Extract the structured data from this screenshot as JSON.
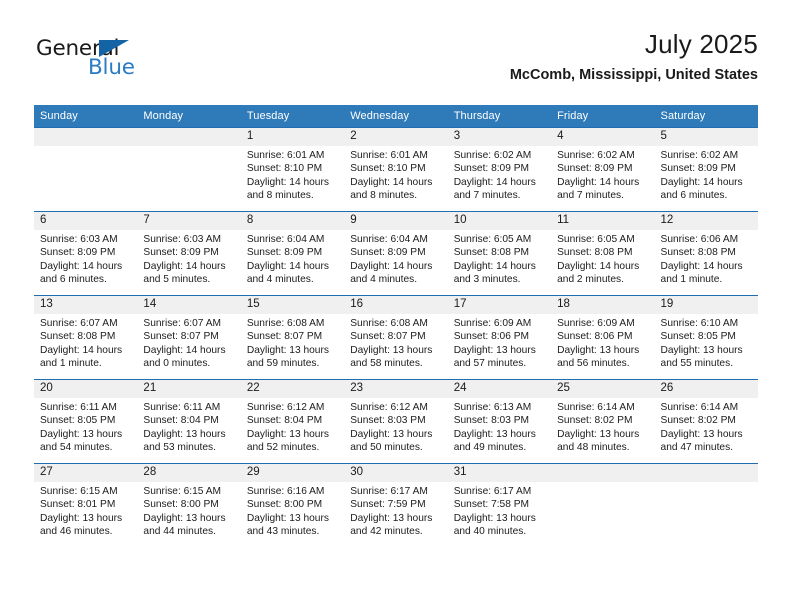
{
  "brand": {
    "name_dark": "General",
    "name_blue": "Blue",
    "accent_blue": "#2b7cc4",
    "triangle_blue": "#1464a5"
  },
  "header": {
    "title": "July 2025",
    "subtitle": "McComb, Mississippi, United States"
  },
  "calendar": {
    "header_bg": "#2f7ab8",
    "daynum_bg": "#f0f0f0",
    "row_border": "#1f6cb0",
    "weekday_labels": [
      "Sunday",
      "Monday",
      "Tuesday",
      "Wednesday",
      "Thursday",
      "Friday",
      "Saturday"
    ],
    "weeks": [
      [
        {
          "day": "",
          "detail": ""
        },
        {
          "day": "",
          "detail": ""
        },
        {
          "day": "1",
          "detail": "Sunrise: 6:01 AM\nSunset: 8:10 PM\nDaylight: 14 hours\nand 8 minutes."
        },
        {
          "day": "2",
          "detail": "Sunrise: 6:01 AM\nSunset: 8:10 PM\nDaylight: 14 hours\nand 8 minutes."
        },
        {
          "day": "3",
          "detail": "Sunrise: 6:02 AM\nSunset: 8:09 PM\nDaylight: 14 hours\nand 7 minutes."
        },
        {
          "day": "4",
          "detail": "Sunrise: 6:02 AM\nSunset: 8:09 PM\nDaylight: 14 hours\nand 7 minutes."
        },
        {
          "day": "5",
          "detail": "Sunrise: 6:02 AM\nSunset: 8:09 PM\nDaylight: 14 hours\nand 6 minutes."
        }
      ],
      [
        {
          "day": "6",
          "detail": "Sunrise: 6:03 AM\nSunset: 8:09 PM\nDaylight: 14 hours\nand 6 minutes."
        },
        {
          "day": "7",
          "detail": "Sunrise: 6:03 AM\nSunset: 8:09 PM\nDaylight: 14 hours\nand 5 minutes."
        },
        {
          "day": "8",
          "detail": "Sunrise: 6:04 AM\nSunset: 8:09 PM\nDaylight: 14 hours\nand 4 minutes."
        },
        {
          "day": "9",
          "detail": "Sunrise: 6:04 AM\nSunset: 8:09 PM\nDaylight: 14 hours\nand 4 minutes."
        },
        {
          "day": "10",
          "detail": "Sunrise: 6:05 AM\nSunset: 8:08 PM\nDaylight: 14 hours\nand 3 minutes."
        },
        {
          "day": "11",
          "detail": "Sunrise: 6:05 AM\nSunset: 8:08 PM\nDaylight: 14 hours\nand 2 minutes."
        },
        {
          "day": "12",
          "detail": "Sunrise: 6:06 AM\nSunset: 8:08 PM\nDaylight: 14 hours\nand 1 minute."
        }
      ],
      [
        {
          "day": "13",
          "detail": "Sunrise: 6:07 AM\nSunset: 8:08 PM\nDaylight: 14 hours\nand 1 minute."
        },
        {
          "day": "14",
          "detail": "Sunrise: 6:07 AM\nSunset: 8:07 PM\nDaylight: 14 hours\nand 0 minutes."
        },
        {
          "day": "15",
          "detail": "Sunrise: 6:08 AM\nSunset: 8:07 PM\nDaylight: 13 hours\nand 59 minutes."
        },
        {
          "day": "16",
          "detail": "Sunrise: 6:08 AM\nSunset: 8:07 PM\nDaylight: 13 hours\nand 58 minutes."
        },
        {
          "day": "17",
          "detail": "Sunrise: 6:09 AM\nSunset: 8:06 PM\nDaylight: 13 hours\nand 57 minutes."
        },
        {
          "day": "18",
          "detail": "Sunrise: 6:09 AM\nSunset: 8:06 PM\nDaylight: 13 hours\nand 56 minutes."
        },
        {
          "day": "19",
          "detail": "Sunrise: 6:10 AM\nSunset: 8:05 PM\nDaylight: 13 hours\nand 55 minutes."
        }
      ],
      [
        {
          "day": "20",
          "detail": "Sunrise: 6:11 AM\nSunset: 8:05 PM\nDaylight: 13 hours\nand 54 minutes."
        },
        {
          "day": "21",
          "detail": "Sunrise: 6:11 AM\nSunset: 8:04 PM\nDaylight: 13 hours\nand 53 minutes."
        },
        {
          "day": "22",
          "detail": "Sunrise: 6:12 AM\nSunset: 8:04 PM\nDaylight: 13 hours\nand 52 minutes."
        },
        {
          "day": "23",
          "detail": "Sunrise: 6:12 AM\nSunset: 8:03 PM\nDaylight: 13 hours\nand 50 minutes."
        },
        {
          "day": "24",
          "detail": "Sunrise: 6:13 AM\nSunset: 8:03 PM\nDaylight: 13 hours\nand 49 minutes."
        },
        {
          "day": "25",
          "detail": "Sunrise: 6:14 AM\nSunset: 8:02 PM\nDaylight: 13 hours\nand 48 minutes."
        },
        {
          "day": "26",
          "detail": "Sunrise: 6:14 AM\nSunset: 8:02 PM\nDaylight: 13 hours\nand 47 minutes."
        }
      ],
      [
        {
          "day": "27",
          "detail": "Sunrise: 6:15 AM\nSunset: 8:01 PM\nDaylight: 13 hours\nand 46 minutes."
        },
        {
          "day": "28",
          "detail": "Sunrise: 6:15 AM\nSunset: 8:00 PM\nDaylight: 13 hours\nand 44 minutes."
        },
        {
          "day": "29",
          "detail": "Sunrise: 6:16 AM\nSunset: 8:00 PM\nDaylight: 13 hours\nand 43 minutes."
        },
        {
          "day": "30",
          "detail": "Sunrise: 6:17 AM\nSunset: 7:59 PM\nDaylight: 13 hours\nand 42 minutes."
        },
        {
          "day": "31",
          "detail": "Sunrise: 6:17 AM\nSunset: 7:58 PM\nDaylight: 13 hours\nand 40 minutes."
        },
        {
          "day": "",
          "detail": ""
        },
        {
          "day": "",
          "detail": ""
        }
      ]
    ]
  }
}
